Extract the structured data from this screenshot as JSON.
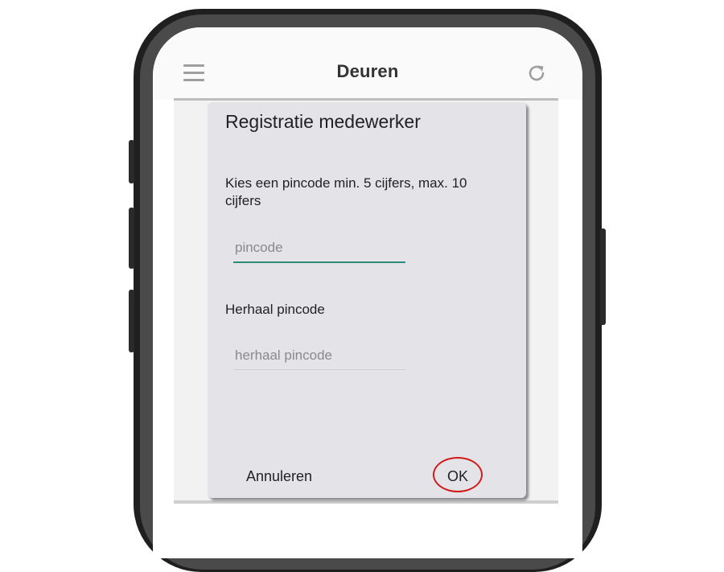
{
  "app": {
    "title": "Deuren",
    "menu_icon": "hamburger-menu-icon",
    "refresh_icon": "refresh-icon"
  },
  "dialog": {
    "title": "Registratie medewerker",
    "prompt": "Kies een pincode min. 5 cijfers, max. 10 cijfers",
    "pincode_placeholder": "pincode",
    "repeat_label": "Herhaal pincode",
    "repeat_placeholder": "herhaal pincode",
    "cancel_label": "Annuleren",
    "ok_label": "OK"
  },
  "colors": {
    "field_focus_underline": "#2e8b7a",
    "highlight_circle": "#d11a1a",
    "dialog_background": "#e4e3e8"
  }
}
